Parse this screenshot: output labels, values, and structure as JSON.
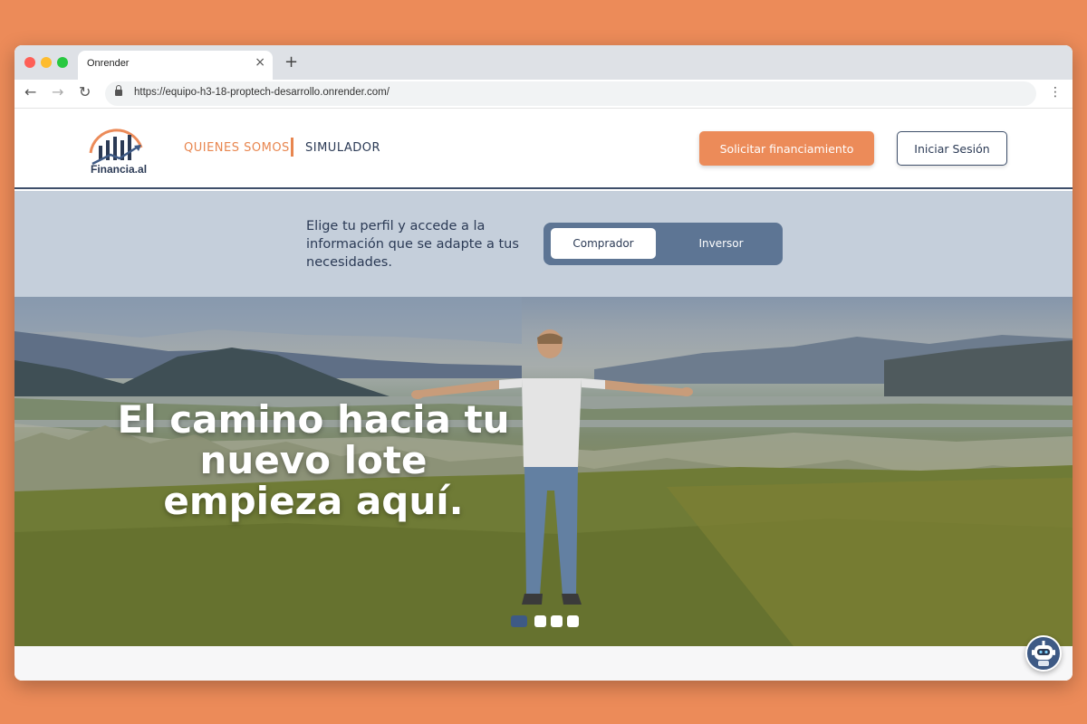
{
  "browser": {
    "tab_title": "Onrender",
    "tab_close": "×",
    "new_tab": "+",
    "url": "https://equipo-h3-18-proptech-desarrollo.onrender.com/",
    "back": "←",
    "forward": "→",
    "reload": "↻",
    "menu": "⋮"
  },
  "header": {
    "logo_text": "Financia.al",
    "nav": [
      {
        "label": "QUIENES SOMOS",
        "active": true
      },
      {
        "label": "SIMULADOR",
        "active": false
      }
    ],
    "cta_label": "Solicitar financiamiento",
    "login_label": "Iniciar Sesión"
  },
  "profile": {
    "prompt": "Elige tu perfil y accede a la información que se adapte a tus necesidades.",
    "options": [
      "Comprador",
      "Inversor"
    ],
    "selected": "Comprador"
  },
  "hero": {
    "title": "El camino hacia tu nuevo lote empieza aquí.",
    "slides_count": 4,
    "active_slide": 1
  },
  "colors": {
    "accent": "#ec8b59",
    "navy": "#2b3a55",
    "toggle_bg": "#5d7594",
    "band_bg": "#c5cfdb"
  }
}
